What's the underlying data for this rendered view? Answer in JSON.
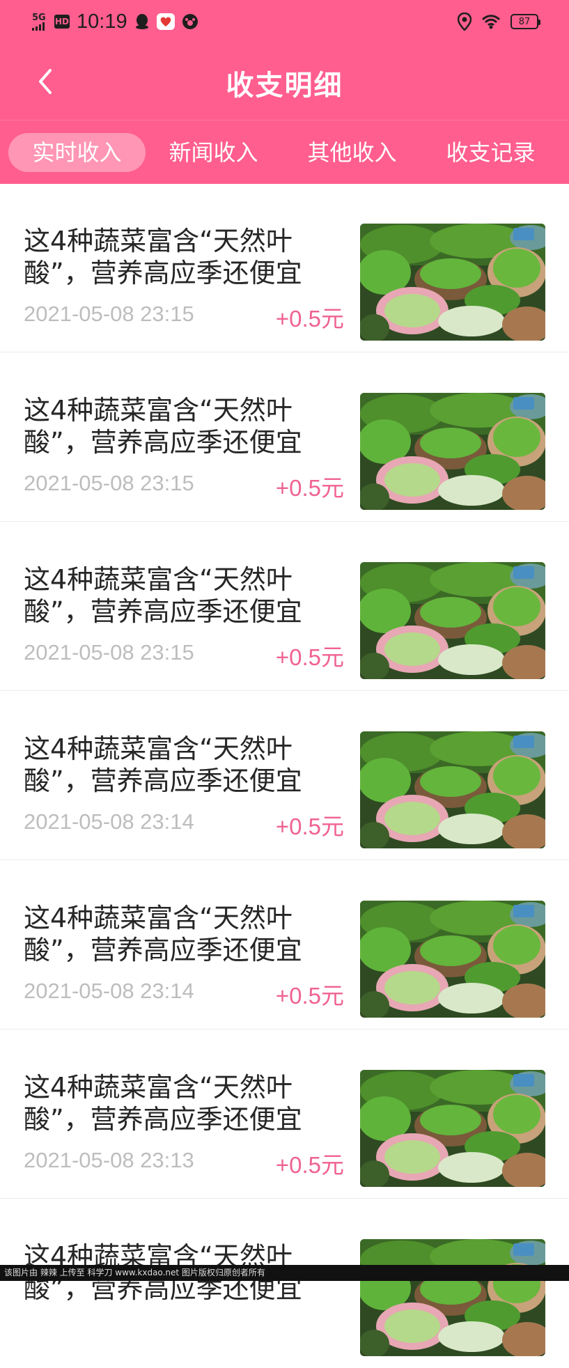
{
  "status_bar": {
    "network": "5G",
    "hd": "HD",
    "time": "10:19",
    "battery": "87",
    "icons": [
      "signal-icon",
      "qq-icon",
      "app-icon",
      "paw-icon",
      "location-icon",
      "wifi-icon"
    ]
  },
  "header": {
    "title": "收支明细",
    "back_icon": "chevron-left-icon"
  },
  "tabs": [
    {
      "label": "实时收入",
      "active": true
    },
    {
      "label": "新闻收入",
      "active": false
    },
    {
      "label": "其他收入",
      "active": false
    },
    {
      "label": "收支记录",
      "active": false
    }
  ],
  "items": [
    {
      "title": "这4种蔬菜富含“天然叶酸”，营养高应季还便宜",
      "date": "2021-05-08 23:15",
      "amount": "+0.5元"
    },
    {
      "title": "这4种蔬菜富含“天然叶酸”，营养高应季还便宜",
      "date": "2021-05-08 23:15",
      "amount": "+0.5元"
    },
    {
      "title": "这4种蔬菜富含“天然叶酸”，营养高应季还便宜",
      "date": "2021-05-08 23:15",
      "amount": "+0.5元"
    },
    {
      "title": "这4种蔬菜富含“天然叶酸”，营养高应季还便宜",
      "date": "2021-05-08 23:14",
      "amount": "+0.5元"
    },
    {
      "title": "这4种蔬菜富含“天然叶酸”，营养高应季还便宜",
      "date": "2021-05-08 23:14",
      "amount": "+0.5元"
    },
    {
      "title": "这4种蔬菜富含“天然叶酸”，营养高应季还便宜",
      "date": "2021-05-08 23:13",
      "amount": "+0.5元"
    },
    {
      "title": "这4种蔬菜富含“天然叶酸”，营养高应季还便宜",
      "date": "",
      "amount": ""
    }
  ],
  "colors": {
    "brand": "#FF5E8F",
    "amount": "#F06292",
    "date": "#bdbdbd"
  },
  "watermark": "该图片由 辣辣 上传至 科学刀 www.kxdao.net 图片版权归原创者所有"
}
